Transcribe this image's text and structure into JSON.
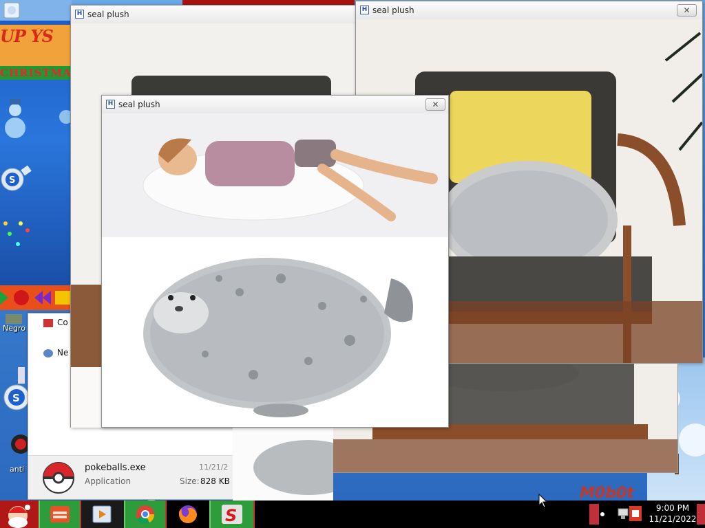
{
  "windows": [
    {
      "title": "seal plush",
      "close_label": "✕"
    },
    {
      "title": "seal plush",
      "close_label": "✕"
    },
    {
      "title": "seal plush",
      "close_label": "✕"
    }
  ],
  "window_icon_letter": "H",
  "promo": {
    "line1": "UP YS",
    "line2": "CHRISTMAS"
  },
  "desktop_icons": {
    "negro": "Negro",
    "anti": "anti"
  },
  "watermark": "M0b0t",
  "explorer": {
    "rows": [
      "Co",
      "Ne"
    ],
    "file_name": "pokeballs.exe",
    "file_type": "Application",
    "date_label": "11/21/2",
    "size_label": "Size:",
    "size_value": "828 KB"
  },
  "clock": {
    "time": "9:00 PM",
    "date": "11/21/2022"
  },
  "colors": {
    "taskbar": "#000000",
    "active_task": "#2e9c3a",
    "accent_red": "#d62a1a"
  }
}
